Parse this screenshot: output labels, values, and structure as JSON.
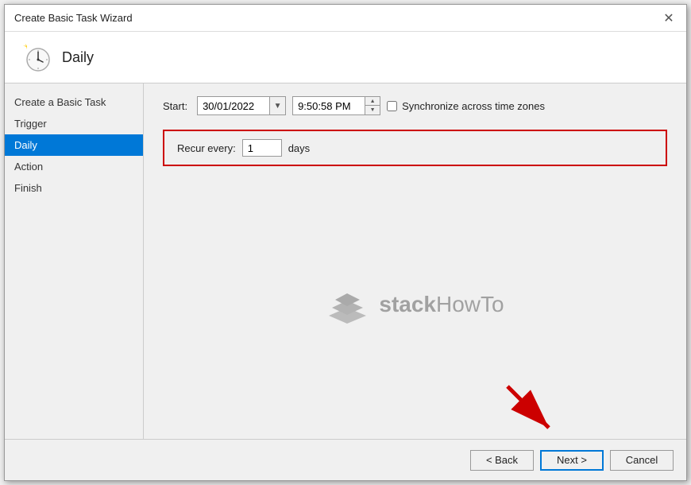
{
  "titleBar": {
    "title": "Create Basic Task Wizard",
    "closeLabel": "✕"
  },
  "header": {
    "title": "Daily"
  },
  "sidebar": {
    "items": [
      {
        "id": "create-basic-task",
        "label": "Create a Basic Task",
        "active": false
      },
      {
        "id": "trigger",
        "label": "Trigger",
        "active": false
      },
      {
        "id": "daily",
        "label": "Daily",
        "active": true
      },
      {
        "id": "action",
        "label": "Action",
        "active": false
      },
      {
        "id": "finish",
        "label": "Finish",
        "active": false
      }
    ]
  },
  "dateTime": {
    "startLabel": "Start:",
    "dateValue": "30/01/2022",
    "timeValue": "9:50:58 PM",
    "syncLabel": "Synchronize across time zones"
  },
  "recur": {
    "label": "Recur every:",
    "value": "1",
    "unit": "days"
  },
  "watermark": {
    "text1": "stack",
    "text2": "HowTo"
  },
  "footer": {
    "backLabel": "< Back",
    "nextLabel": "Next >",
    "cancelLabel": "Cancel"
  }
}
